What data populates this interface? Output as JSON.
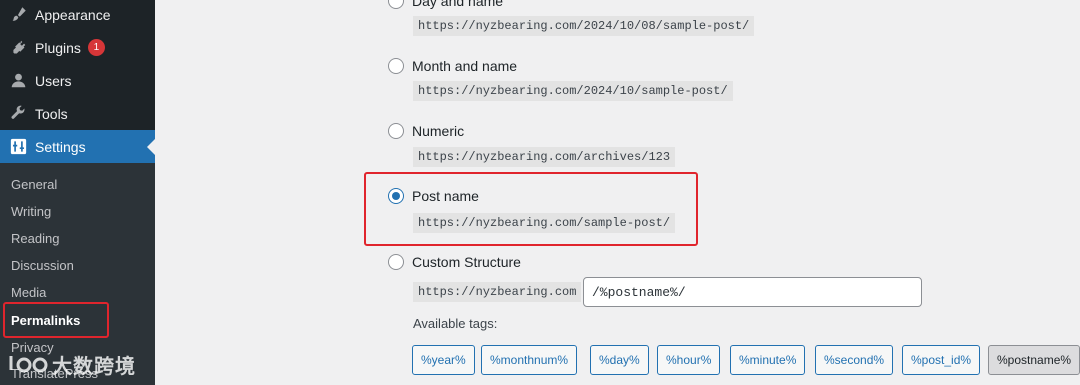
{
  "sidebar": {
    "menu": [
      {
        "label": "Appearance",
        "icon": "paintbrush-icon"
      },
      {
        "label": "Plugins",
        "icon": "plugin-icon",
        "badge": "1"
      },
      {
        "label": "Users",
        "icon": "user-icon"
      },
      {
        "label": "Tools",
        "icon": "wrench-icon"
      },
      {
        "label": "Settings",
        "icon": "settings-icon",
        "active": true
      }
    ],
    "submenu": [
      "General",
      "Writing",
      "Reading",
      "Discussion",
      "Media",
      "Permalinks",
      "Privacy",
      "TranslatePress"
    ],
    "current_submenu": "Permalinks"
  },
  "watermark": {
    "text": "大数跨境"
  },
  "permalinks": {
    "options": [
      {
        "label": "Day and name",
        "example": "https://nyzbearing.com/2024/10/08/sample-post/",
        "checked": false
      },
      {
        "label": "Month and name",
        "example": "https://nyzbearing.com/2024/10/sample-post/",
        "checked": false
      },
      {
        "label": "Numeric",
        "example": "https://nyzbearing.com/archives/123",
        "checked": false
      },
      {
        "label": "Post name",
        "example": "https://nyzbearing.com/sample-post/",
        "checked": true
      },
      {
        "label": "Custom Structure",
        "checked": false
      }
    ],
    "custom": {
      "base": "https://nyzbearing.com",
      "value": "/%postname%/"
    },
    "available_tags_label": "Available tags:",
    "tags": [
      "%year%",
      "%monthnum%",
      "%day%",
      "%hour%",
      "%minute%",
      "%second%",
      "%post_id%",
      "%postname%"
    ],
    "active_tag": "%postname%"
  },
  "colors": {
    "sidebar_bg": "#1d2327",
    "active_bg": "#2271b1",
    "highlight": "#e0252d",
    "badge": "#d63638"
  }
}
